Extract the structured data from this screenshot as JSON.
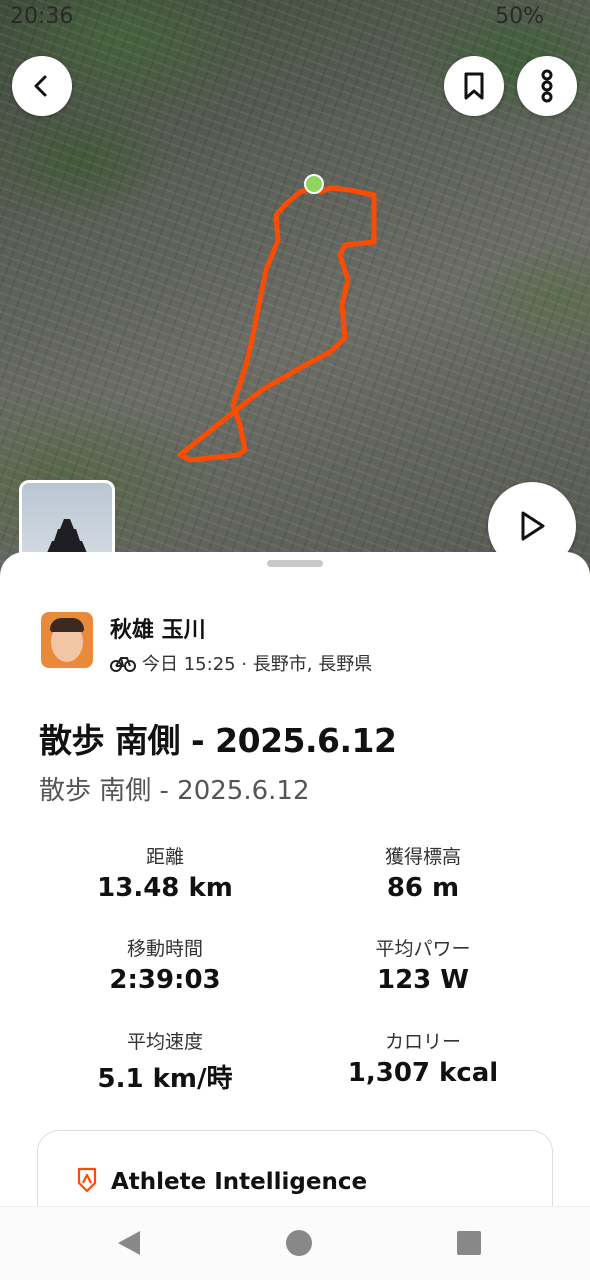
{
  "status_bar": {
    "time": "20:36",
    "battery": "50%"
  },
  "map": {
    "route_color": "#fc4c02",
    "start_color": "#8ed65a"
  },
  "activity": {
    "athlete_name": "秋雄 玉川",
    "meta": "今日 15:25 · 長野市, 長野県",
    "title": "散歩 南側 - 2025.6.12",
    "description": "散歩 南側 - 2025.6.12"
  },
  "stats": [
    {
      "label": "距離",
      "value": "13.48 km"
    },
    {
      "label": "獲得標高",
      "value": "86 m"
    },
    {
      "label": "移動時間",
      "value": "2:39:03"
    },
    {
      "label": "平均パワー",
      "value": "123 W"
    },
    {
      "label": "平均速度",
      "value": "5.1 km/時"
    },
    {
      "label": "カロリー",
      "value": "1,307 kcal"
    }
  ],
  "athlete_intelligence": {
    "title": "Athlete Intelligence"
  },
  "icons": {
    "back": "back-icon",
    "bookmark": "bookmark-icon",
    "more": "more-icon",
    "play": "play-icon",
    "bike": "bike-icon",
    "ai": "athlete-intelligence-icon"
  }
}
